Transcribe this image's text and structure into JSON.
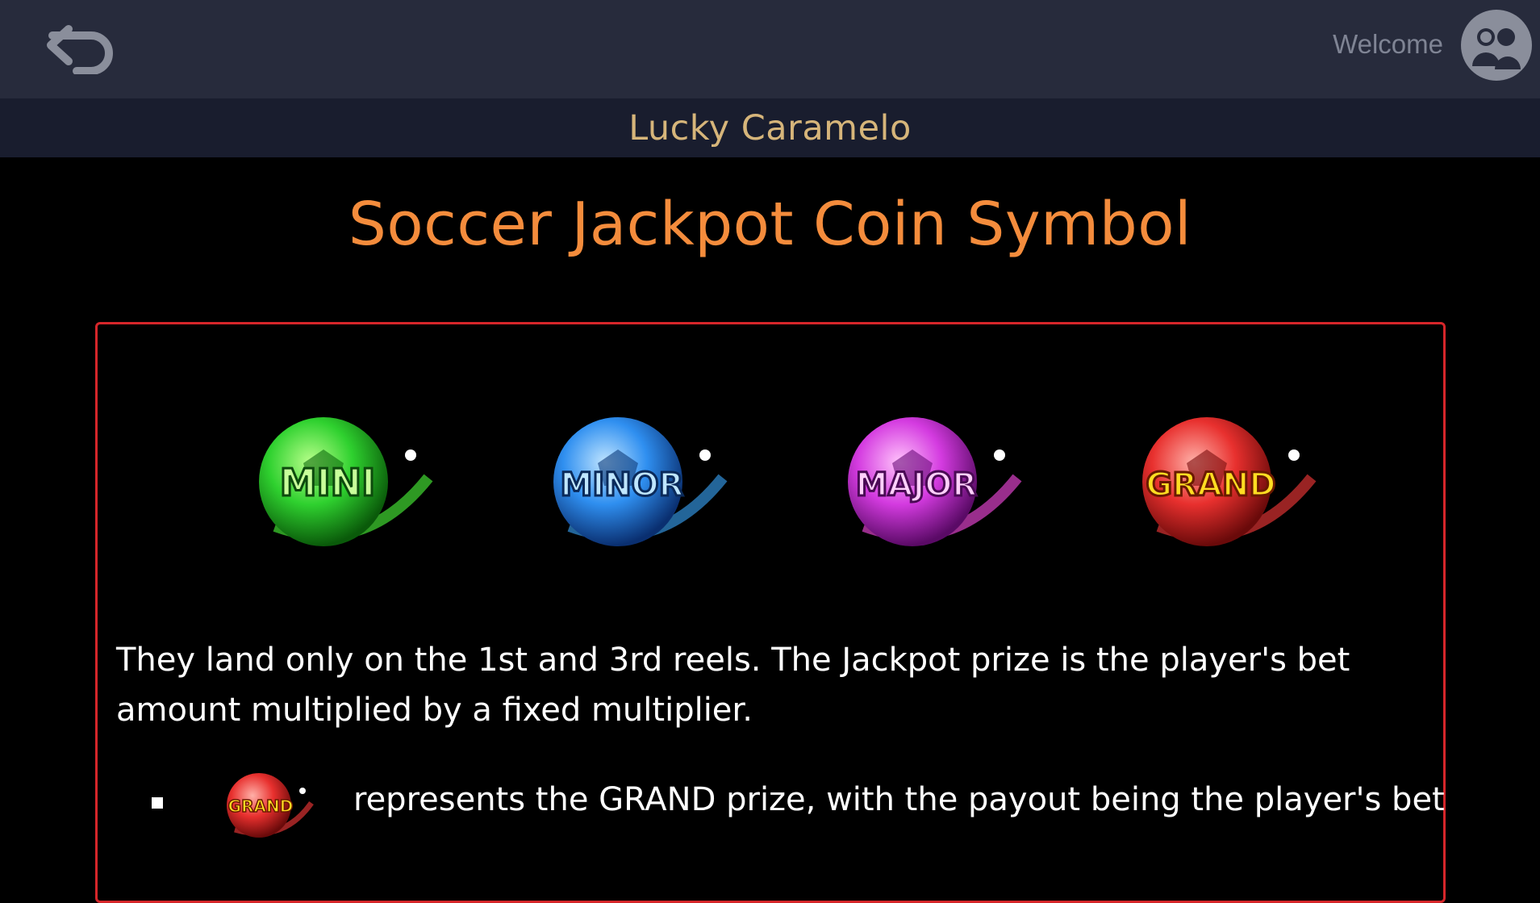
{
  "header": {
    "back_icon": "back-arrow-icon",
    "welcome_text": "Welcome",
    "avatar_icon": "user-avatar-icon"
  },
  "subheader": {
    "game_title": "Lucky Caramelo"
  },
  "page": {
    "title": "Soccer Jackpot Coin Symbol"
  },
  "coins": [
    {
      "label": "MINI",
      "color": "#2fd12f",
      "glow": "#8bff5a"
    },
    {
      "label": "MINOR",
      "color": "#2f8ff0",
      "glow": "#7cc6ff"
    },
    {
      "label": "MAJOR",
      "color": "#d43be0",
      "glow": "#ff8cf5"
    },
    {
      "label": "GRAND",
      "color": "#e8302e",
      "glow": "#ffdd22"
    }
  ],
  "description": "They land only on the 1st and 3rd reels. The Jackpot prize is the player's bet amount multiplied by a fixed multiplier.",
  "bullets": [
    {
      "icon_label": "GRAND",
      "text": "represents the GRAND prize, with the payout being the player's bet"
    }
  ],
  "colors": {
    "topbar": "#272b3c",
    "subbar": "#191d2e",
    "game_title": "#d6b57a",
    "page_title": "#f48c3c",
    "panel_border": "#d6262a"
  }
}
